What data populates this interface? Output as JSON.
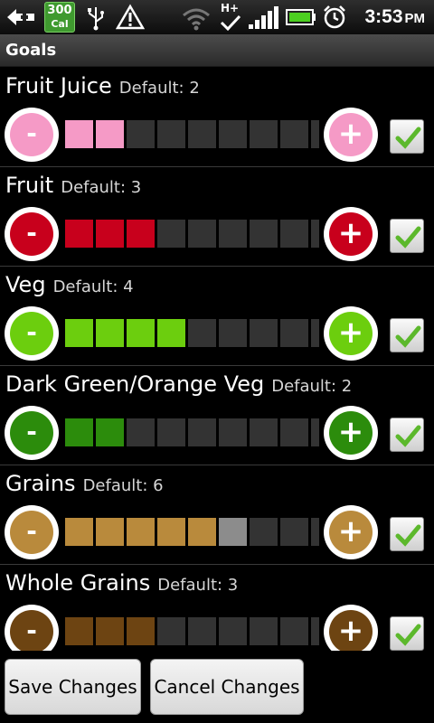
{
  "status_bar": {
    "calories_value": "300",
    "calories_unit": "Cal",
    "time": "3:53",
    "ampm": "PM",
    "network": "H+",
    "icons": [
      "back-icon",
      "usb-icon",
      "warning-icon",
      "wifi-icon",
      "signal-icon",
      "battery-icon",
      "alarm-icon"
    ]
  },
  "title_bar": {
    "title": "Goals"
  },
  "goals": [
    {
      "name": "Fruit Juice",
      "default": "Default: 2",
      "value": 2,
      "segments": 9,
      "color": "#f59ac6",
      "checked": true
    },
    {
      "name": "Fruit",
      "default": "Default: 3",
      "value": 3,
      "segments": 9,
      "color": "#c8001c",
      "checked": true
    },
    {
      "name": "Veg",
      "default": "Default: 4",
      "value": 4,
      "segments": 9,
      "color": "#6cce0e",
      "checked": true
    },
    {
      "name": "Dark Green/Orange Veg",
      "default": "Default: 2",
      "value": 2,
      "segments": 9,
      "color": "#2c8c0c",
      "checked": true
    },
    {
      "name": "Grains",
      "default": "Default: 6",
      "value": 5,
      "highlight": 6,
      "segments": 9,
      "color": "#b98a3c",
      "checked": true
    },
    {
      "name": "Whole Grains",
      "default": "Default: 3",
      "value": 3,
      "segments": 9,
      "color": "#6d4412",
      "checked": true
    }
  ],
  "buttons": {
    "minus_label": "-",
    "plus_label": "+",
    "save": "Save Changes",
    "cancel": "Cancel Changes"
  },
  "colors": {
    "empty_segment": "#333333",
    "default_marker_segment": "#8c8c8c",
    "check_green": "#5cb82c"
  }
}
